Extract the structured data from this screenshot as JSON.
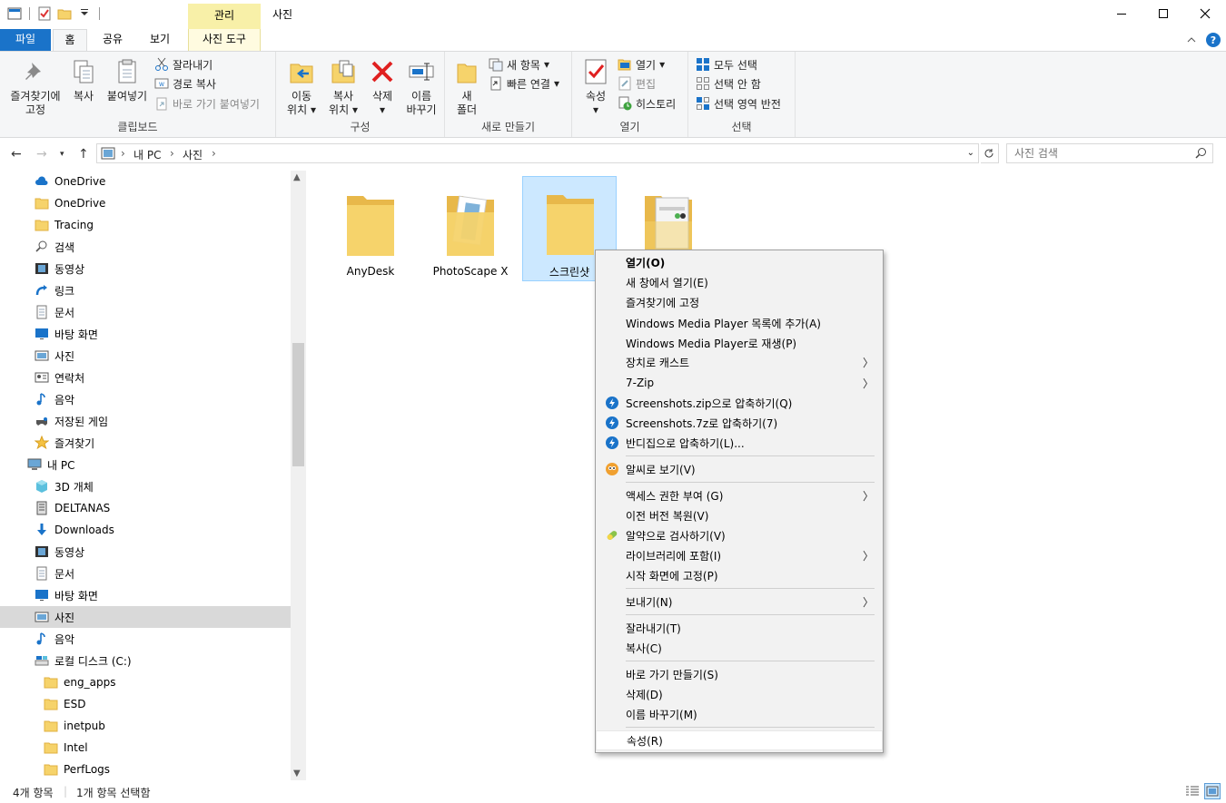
{
  "titlebar": {
    "manage_tab": "관리",
    "title": "사진"
  },
  "tabs": {
    "file": "파일",
    "home": "홈",
    "share": "공유",
    "view": "보기",
    "photo_tools": "사진 도구"
  },
  "ribbon": {
    "clipboard": {
      "label": "클립보드",
      "pin_l1": "즐겨찾기에",
      "pin_l2": "고정",
      "copy": "복사",
      "paste": "붙여넣기",
      "cut": "잘라내기",
      "copy_path": "경로 복사",
      "paste_shortcut": "바로 가기 붙여넣기"
    },
    "organize": {
      "label": "구성",
      "move_l1": "이동",
      "move_l2": "위치",
      "copyto_l1": "복사",
      "copyto_l2": "위치",
      "delete": "삭제",
      "rename_l1": "이름",
      "rename_l2": "바꾸기"
    },
    "new": {
      "label": "새로 만들기",
      "new_folder_l1": "새",
      "new_folder_l2": "폴더",
      "new_item": "새 항목",
      "easy_access": "빠른 연결"
    },
    "open": {
      "label": "열기",
      "properties": "속성",
      "open": "열기",
      "edit": "편집",
      "history": "히스토리"
    },
    "select": {
      "label": "선택",
      "select_all": "모두 선택",
      "select_none": "선택 안 함",
      "invert": "선택 영역 반전"
    }
  },
  "address": {
    "crumb_pc": "내 PC",
    "crumb_folder": "사진",
    "search_placeholder": "사진 검색"
  },
  "sidebar": {
    "items": [
      {
        "label": "OneDrive",
        "icon": "cloud-icon"
      },
      {
        "label": "OneDrive",
        "icon": "folder-icon"
      },
      {
        "label": "Tracing",
        "icon": "folder-icon"
      },
      {
        "label": "검색",
        "icon": "search-icon"
      },
      {
        "label": "동영상",
        "icon": "video-icon"
      },
      {
        "label": "링크",
        "icon": "link-icon"
      },
      {
        "label": "문서",
        "icon": "document-icon"
      },
      {
        "label": "바탕 화면",
        "icon": "desktop-icon"
      },
      {
        "label": "사진",
        "icon": "pictures-icon"
      },
      {
        "label": "연락처",
        "icon": "contacts-icon"
      },
      {
        "label": "음악",
        "icon": "music-icon"
      },
      {
        "label": "저장된 게임",
        "icon": "game-icon"
      },
      {
        "label": "즐겨찾기",
        "icon": "star-icon"
      },
      {
        "label": "내 PC",
        "icon": "pc-icon"
      },
      {
        "label": "3D 개체",
        "icon": "cube-icon"
      },
      {
        "label": "DELTANAS",
        "icon": "nas-icon"
      },
      {
        "label": "Downloads",
        "icon": "download-icon"
      },
      {
        "label": "동영상",
        "icon": "video-icon"
      },
      {
        "label": "문서",
        "icon": "document-icon"
      },
      {
        "label": "바탕 화면",
        "icon": "desktop-icon"
      },
      {
        "label": "사진",
        "icon": "pictures-icon"
      },
      {
        "label": "음악",
        "icon": "music-icon"
      },
      {
        "label": "로컬 디스크 (C:)",
        "icon": "drive-icon"
      },
      {
        "label": "eng_apps",
        "icon": "folder-icon"
      },
      {
        "label": "ESD",
        "icon": "folder-icon"
      },
      {
        "label": "inetpub",
        "icon": "folder-icon"
      },
      {
        "label": "Intel",
        "icon": "folder-icon"
      },
      {
        "label": "PerfLogs",
        "icon": "folder-icon"
      }
    ]
  },
  "files": [
    {
      "label": "AnyDesk"
    },
    {
      "label": "PhotoScape X"
    },
    {
      "label": "스크린샷"
    },
    {
      "label": ""
    }
  ],
  "context_menu": {
    "open": "열기(O)",
    "open_new_window": "새 창에서 열기(E)",
    "pin_quick": "즐겨찾기에 고정",
    "wmp_add": "Windows Media Player 목록에 추가(A)",
    "wmp_play": "Windows Media Player로 재생(P)",
    "cast": "장치로 캐스트",
    "zip7": "7-Zip",
    "compress_zip": "Screenshots.zip으로 압축하기(Q)",
    "compress_7z": "Screenshots.7z로 압축하기(7)",
    "bandizip": "반디집으로 압축하기(L)...",
    "alsee": "알씨로 보기(V)",
    "give_access": "액세스 권한 부여 (G)",
    "restore": "이전 버전 복원(V)",
    "alyac": "알약으로 검사하기(V)",
    "include_library": "라이브러리에 포함(I)",
    "pin_start": "시작 화면에 고정(P)",
    "send_to": "보내기(N)",
    "cut": "잘라내기(T)",
    "copy": "복사(C)",
    "create_shortcut": "바로 가기 만들기(S)",
    "delete": "삭제(D)",
    "rename": "이름 바꾸기(M)",
    "properties": "속성(R)"
  },
  "status": {
    "count": "4개 항목",
    "selected": "1개 항목 선택함"
  },
  "colors": {
    "accent": "#1a73c9",
    "selection": "#cce8ff",
    "folder": "#f6d36b"
  }
}
